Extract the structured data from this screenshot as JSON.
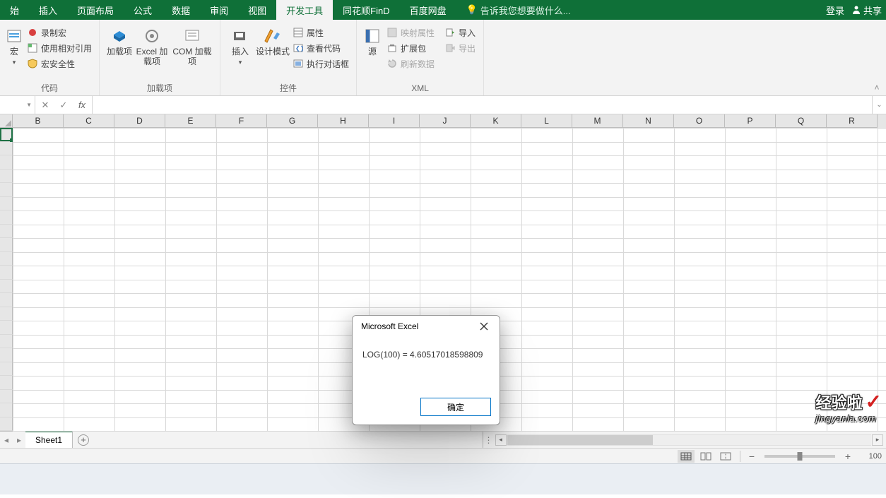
{
  "titlebar": {
    "tabs": [
      "始",
      "插入",
      "页面布局",
      "公式",
      "数据",
      "审阅",
      "视图",
      "开发工具",
      "同花顺FinD",
      "百度网盘"
    ],
    "activeIndex": 7,
    "tellme": "告诉我您想要做什么...",
    "login": "登录",
    "share": "共享"
  },
  "ribbon": {
    "groups": [
      {
        "label": "代码",
        "big": [
          {
            "label": "宏"
          }
        ],
        "small": [
          {
            "label": "录制宏"
          },
          {
            "label": "使用相对引用"
          },
          {
            "label": "宏安全性"
          }
        ]
      },
      {
        "label": "加载项",
        "big": [
          {
            "label": "加载项",
            "sub": ""
          },
          {
            "label": "Excel 加载项",
            "sub": ""
          },
          {
            "label": "COM 加载项",
            "sub": ""
          }
        ]
      },
      {
        "label": "控件",
        "big": [
          {
            "label": "插入",
            "sub": ""
          },
          {
            "label": "设计模式",
            "sub": ""
          }
        ],
        "small": [
          {
            "label": "属性"
          },
          {
            "label": "查看代码"
          },
          {
            "label": "执行对话框"
          }
        ]
      },
      {
        "label": "XML",
        "big": [
          {
            "label": "源"
          }
        ],
        "small": [
          {
            "label": "映射属性",
            "disabled": true
          },
          {
            "label": "扩展包"
          },
          {
            "label": "刷新数据",
            "disabled": true
          }
        ],
        "small2": [
          {
            "label": "导入"
          },
          {
            "label": "导出",
            "disabled": true
          }
        ]
      }
    ]
  },
  "formulaBar": {
    "nameBox": "",
    "formula": ""
  },
  "columns": [
    "B",
    "C",
    "D",
    "E",
    "F",
    "G",
    "H",
    "I",
    "J",
    "K",
    "L",
    "M",
    "N",
    "O",
    "P",
    "Q",
    "R"
  ],
  "dialog": {
    "title": "Microsoft Excel",
    "message": "LOG(100) = 4.60517018598809",
    "ok": "确定"
  },
  "sheetTabs": {
    "items": [
      "Sheet1"
    ],
    "activeIndex": 0
  },
  "status": {
    "zoomLabel": "100"
  },
  "watermark": {
    "top": "经验啦",
    "bottom": "jingyanla.com"
  }
}
